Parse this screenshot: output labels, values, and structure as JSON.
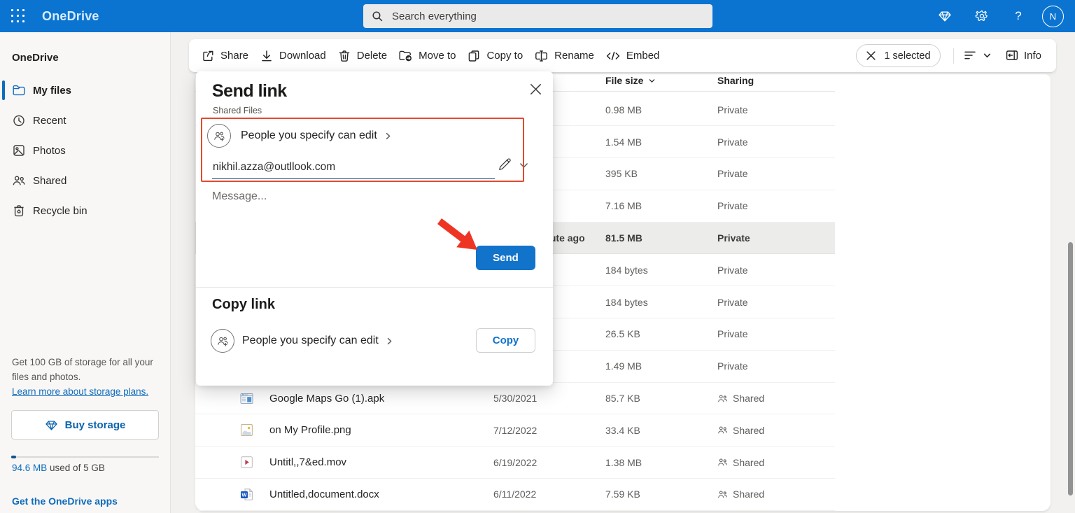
{
  "topbar": {
    "app_title": "OneDrive",
    "search_placeholder": "Search everything",
    "avatar_initial": "N"
  },
  "sidebar": {
    "heading": "OneDrive",
    "items": [
      {
        "label": "My files",
        "selected": true
      },
      {
        "label": "Recent",
        "selected": false
      },
      {
        "label": "Photos",
        "selected": false
      },
      {
        "label": "Shared",
        "selected": false
      },
      {
        "label": "Recycle bin",
        "selected": false
      }
    ],
    "storage": {
      "promo": "Get 100 GB of storage for all your files and photos.",
      "learn_more": "Learn more about storage plans.",
      "buy_button": "Buy storage",
      "usage_value": "94.6 MB",
      "usage_suffix": " used of 5 GB",
      "apps_link": "Get the OneDrive apps"
    }
  },
  "toolbar": {
    "actions": [
      "Share",
      "Download",
      "Delete",
      "Move to",
      "Copy to",
      "Rename",
      "Embed"
    ],
    "selected_count": "1 selected",
    "info_label": "Info"
  },
  "dialog": {
    "title": "Send link",
    "subtitle": "Shared Files",
    "permission_label": "People you specify can edit",
    "email": "nikhil.azza@outllook.com",
    "message_placeholder": "Message...",
    "send_button": "Send",
    "copy_title": "Copy link",
    "copy_permission_label": "People you specify can edit",
    "copy_button": "Copy"
  },
  "filelist": {
    "columns": {
      "size": "File size",
      "sharing": "Sharing"
    },
    "rows": [
      {
        "name": "",
        "icon": "",
        "modified": "",
        "size": "0.98 MB",
        "sharing": "Private",
        "selected": false
      },
      {
        "name": "",
        "icon": "",
        "modified": "",
        "size": "1.54 MB",
        "sharing": "Private",
        "selected": false
      },
      {
        "name": "",
        "icon": "",
        "modified": "",
        "size": "395 KB",
        "sharing": "Private",
        "selected": false
      },
      {
        "name": "",
        "icon": "",
        "modified": "",
        "size": "7.16 MB",
        "sharing": "Private",
        "selected": false
      },
      {
        "name": "",
        "icon": "",
        "modified": "About a minute ago",
        "size": "81.5 MB",
        "sharing": "Private",
        "selected": true
      },
      {
        "name": "",
        "icon": "",
        "modified": "",
        "size": "184 bytes",
        "sharing": "Private",
        "selected": false
      },
      {
        "name": "",
        "icon": "",
        "modified": "",
        "size": "184 bytes",
        "sharing": "Private",
        "selected": false
      },
      {
        "name": "",
        "icon": "",
        "modified": "",
        "size": "26.5 KB",
        "sharing": "Private",
        "selected": false
      },
      {
        "name": "",
        "icon": "",
        "modified": "",
        "size": "1.49 MB",
        "sharing": "Private",
        "selected": false
      },
      {
        "name": "Google Maps Go (1).apk",
        "icon": "apk",
        "modified": "5/30/2021",
        "size": "85.7 KB",
        "sharing": "Shared",
        "selected": false
      },
      {
        "name": "on My Profile.png",
        "icon": "image",
        "modified": "7/12/2022",
        "size": "33.4 KB",
        "sharing": "Shared",
        "selected": false
      },
      {
        "name": "Untitl,,7&ed.mov",
        "icon": "video",
        "modified": "6/19/2022",
        "size": "1.38 MB",
        "sharing": "Shared",
        "selected": false
      },
      {
        "name": "Untitled,document.docx",
        "icon": "word",
        "modified": "6/11/2022",
        "size": "7.59 KB",
        "sharing": "Shared",
        "selected": false
      }
    ]
  }
}
